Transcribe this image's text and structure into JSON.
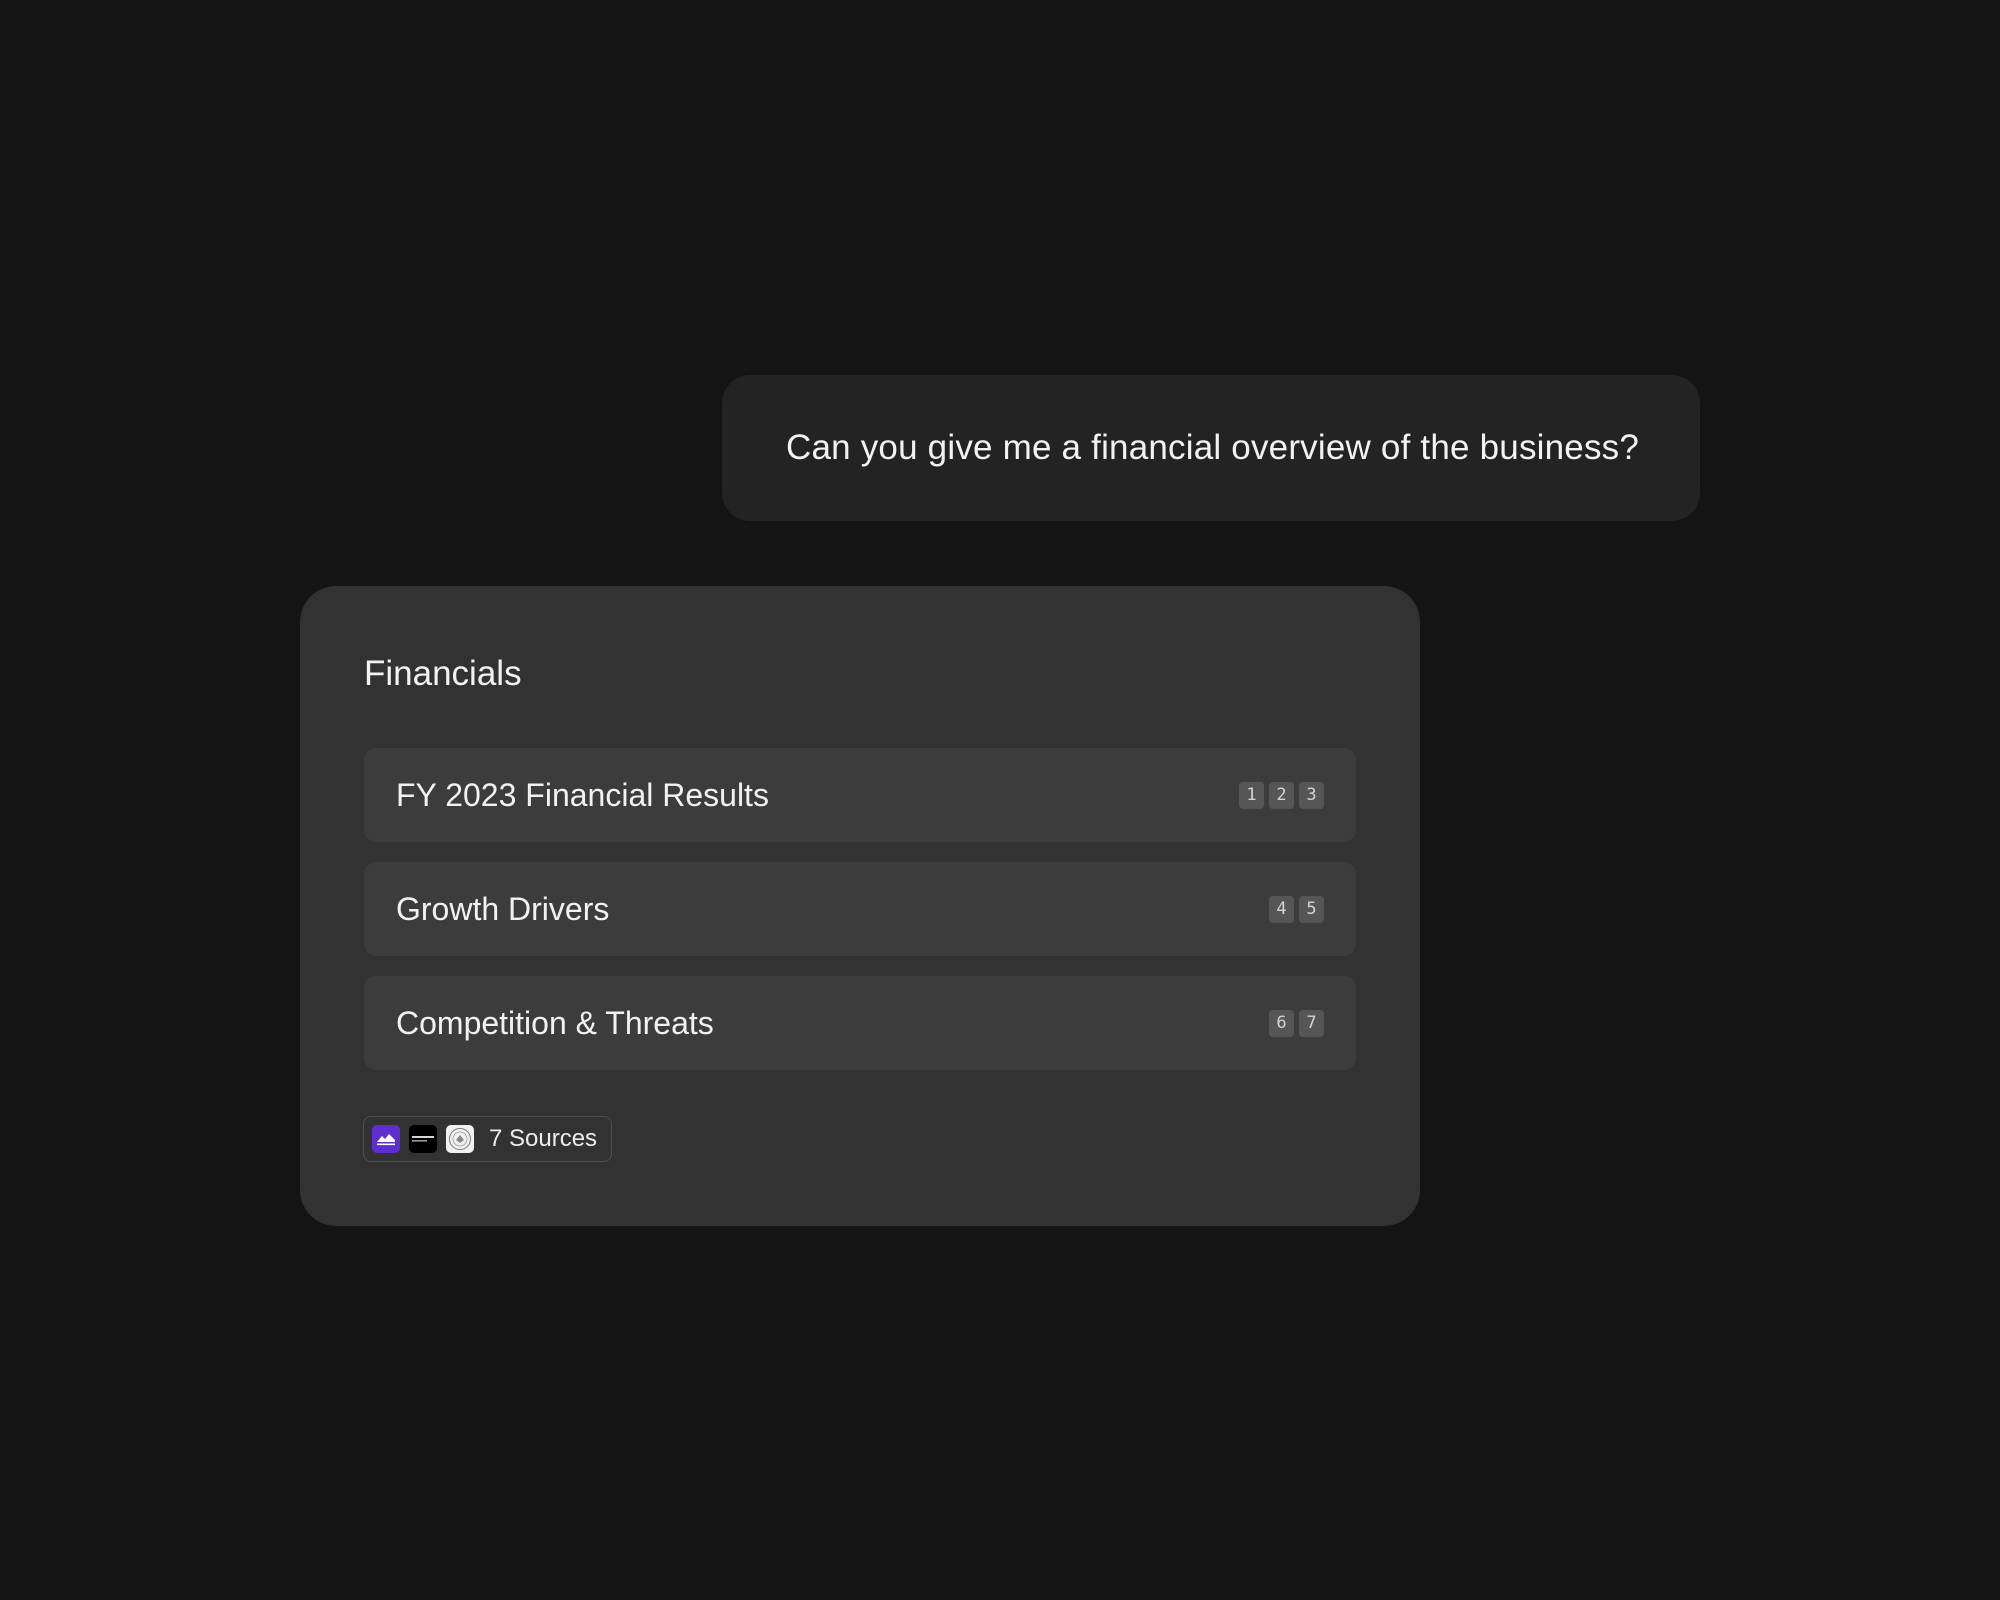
{
  "chat": {
    "user_message": "Can you give me a financial overview of the business?"
  },
  "answer": {
    "title": "Financials",
    "topics": [
      {
        "label": "FY 2023 Financial Results",
        "citations": [
          "1",
          "2",
          "3"
        ]
      },
      {
        "label": "Growth Drivers",
        "citations": [
          "4",
          "5"
        ]
      },
      {
        "label": "Competition & Threats",
        "citations": [
          "6",
          "7"
        ]
      }
    ],
    "sources": {
      "label": "7 Sources",
      "icons": [
        "yahoo-finance-icon",
        "bloomberg-icon",
        "sec-seal-icon"
      ]
    }
  },
  "colors": {
    "background": "#141414",
    "user_bubble": "#232323",
    "card": "#323232",
    "topic_row": "#3c3c3c",
    "citation_badge": "#565656",
    "yahoo_purple": "#5f2ed1"
  }
}
